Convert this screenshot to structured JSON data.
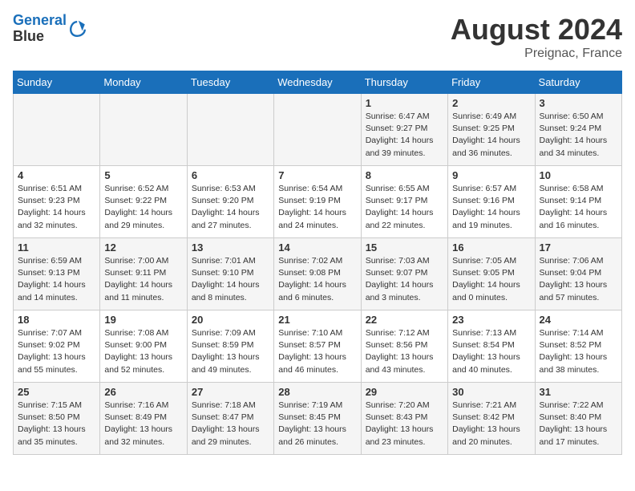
{
  "header": {
    "logo_line1": "General",
    "logo_line2": "Blue",
    "month_year": "August 2024",
    "location": "Preignac, France"
  },
  "weekdays": [
    "Sunday",
    "Monday",
    "Tuesday",
    "Wednesday",
    "Thursday",
    "Friday",
    "Saturday"
  ],
  "weeks": [
    [
      {
        "day": "",
        "info": ""
      },
      {
        "day": "",
        "info": ""
      },
      {
        "day": "",
        "info": ""
      },
      {
        "day": "",
        "info": ""
      },
      {
        "day": "1",
        "info": "Sunrise: 6:47 AM\nSunset: 9:27 PM\nDaylight: 14 hours and 39 minutes."
      },
      {
        "day": "2",
        "info": "Sunrise: 6:49 AM\nSunset: 9:25 PM\nDaylight: 14 hours and 36 minutes."
      },
      {
        "day": "3",
        "info": "Sunrise: 6:50 AM\nSunset: 9:24 PM\nDaylight: 14 hours and 34 minutes."
      }
    ],
    [
      {
        "day": "4",
        "info": "Sunrise: 6:51 AM\nSunset: 9:23 PM\nDaylight: 14 hours and 32 minutes."
      },
      {
        "day": "5",
        "info": "Sunrise: 6:52 AM\nSunset: 9:22 PM\nDaylight: 14 hours and 29 minutes."
      },
      {
        "day": "6",
        "info": "Sunrise: 6:53 AM\nSunset: 9:20 PM\nDaylight: 14 hours and 27 minutes."
      },
      {
        "day": "7",
        "info": "Sunrise: 6:54 AM\nSunset: 9:19 PM\nDaylight: 14 hours and 24 minutes."
      },
      {
        "day": "8",
        "info": "Sunrise: 6:55 AM\nSunset: 9:17 PM\nDaylight: 14 hours and 22 minutes."
      },
      {
        "day": "9",
        "info": "Sunrise: 6:57 AM\nSunset: 9:16 PM\nDaylight: 14 hours and 19 minutes."
      },
      {
        "day": "10",
        "info": "Sunrise: 6:58 AM\nSunset: 9:14 PM\nDaylight: 14 hours and 16 minutes."
      }
    ],
    [
      {
        "day": "11",
        "info": "Sunrise: 6:59 AM\nSunset: 9:13 PM\nDaylight: 14 hours and 14 minutes."
      },
      {
        "day": "12",
        "info": "Sunrise: 7:00 AM\nSunset: 9:11 PM\nDaylight: 14 hours and 11 minutes."
      },
      {
        "day": "13",
        "info": "Sunrise: 7:01 AM\nSunset: 9:10 PM\nDaylight: 14 hours and 8 minutes."
      },
      {
        "day": "14",
        "info": "Sunrise: 7:02 AM\nSunset: 9:08 PM\nDaylight: 14 hours and 6 minutes."
      },
      {
        "day": "15",
        "info": "Sunrise: 7:03 AM\nSunset: 9:07 PM\nDaylight: 14 hours and 3 minutes."
      },
      {
        "day": "16",
        "info": "Sunrise: 7:05 AM\nSunset: 9:05 PM\nDaylight: 14 hours and 0 minutes."
      },
      {
        "day": "17",
        "info": "Sunrise: 7:06 AM\nSunset: 9:04 PM\nDaylight: 13 hours and 57 minutes."
      }
    ],
    [
      {
        "day": "18",
        "info": "Sunrise: 7:07 AM\nSunset: 9:02 PM\nDaylight: 13 hours and 55 minutes."
      },
      {
        "day": "19",
        "info": "Sunrise: 7:08 AM\nSunset: 9:00 PM\nDaylight: 13 hours and 52 minutes."
      },
      {
        "day": "20",
        "info": "Sunrise: 7:09 AM\nSunset: 8:59 PM\nDaylight: 13 hours and 49 minutes."
      },
      {
        "day": "21",
        "info": "Sunrise: 7:10 AM\nSunset: 8:57 PM\nDaylight: 13 hours and 46 minutes."
      },
      {
        "day": "22",
        "info": "Sunrise: 7:12 AM\nSunset: 8:56 PM\nDaylight: 13 hours and 43 minutes."
      },
      {
        "day": "23",
        "info": "Sunrise: 7:13 AM\nSunset: 8:54 PM\nDaylight: 13 hours and 40 minutes."
      },
      {
        "day": "24",
        "info": "Sunrise: 7:14 AM\nSunset: 8:52 PM\nDaylight: 13 hours and 38 minutes."
      }
    ],
    [
      {
        "day": "25",
        "info": "Sunrise: 7:15 AM\nSunset: 8:50 PM\nDaylight: 13 hours and 35 minutes."
      },
      {
        "day": "26",
        "info": "Sunrise: 7:16 AM\nSunset: 8:49 PM\nDaylight: 13 hours and 32 minutes."
      },
      {
        "day": "27",
        "info": "Sunrise: 7:18 AM\nSunset: 8:47 PM\nDaylight: 13 hours and 29 minutes."
      },
      {
        "day": "28",
        "info": "Sunrise: 7:19 AM\nSunset: 8:45 PM\nDaylight: 13 hours and 26 minutes."
      },
      {
        "day": "29",
        "info": "Sunrise: 7:20 AM\nSunset: 8:43 PM\nDaylight: 13 hours and 23 minutes."
      },
      {
        "day": "30",
        "info": "Sunrise: 7:21 AM\nSunset: 8:42 PM\nDaylight: 13 hours and 20 minutes."
      },
      {
        "day": "31",
        "info": "Sunrise: 7:22 AM\nSunset: 8:40 PM\nDaylight: 13 hours and 17 minutes."
      }
    ]
  ]
}
